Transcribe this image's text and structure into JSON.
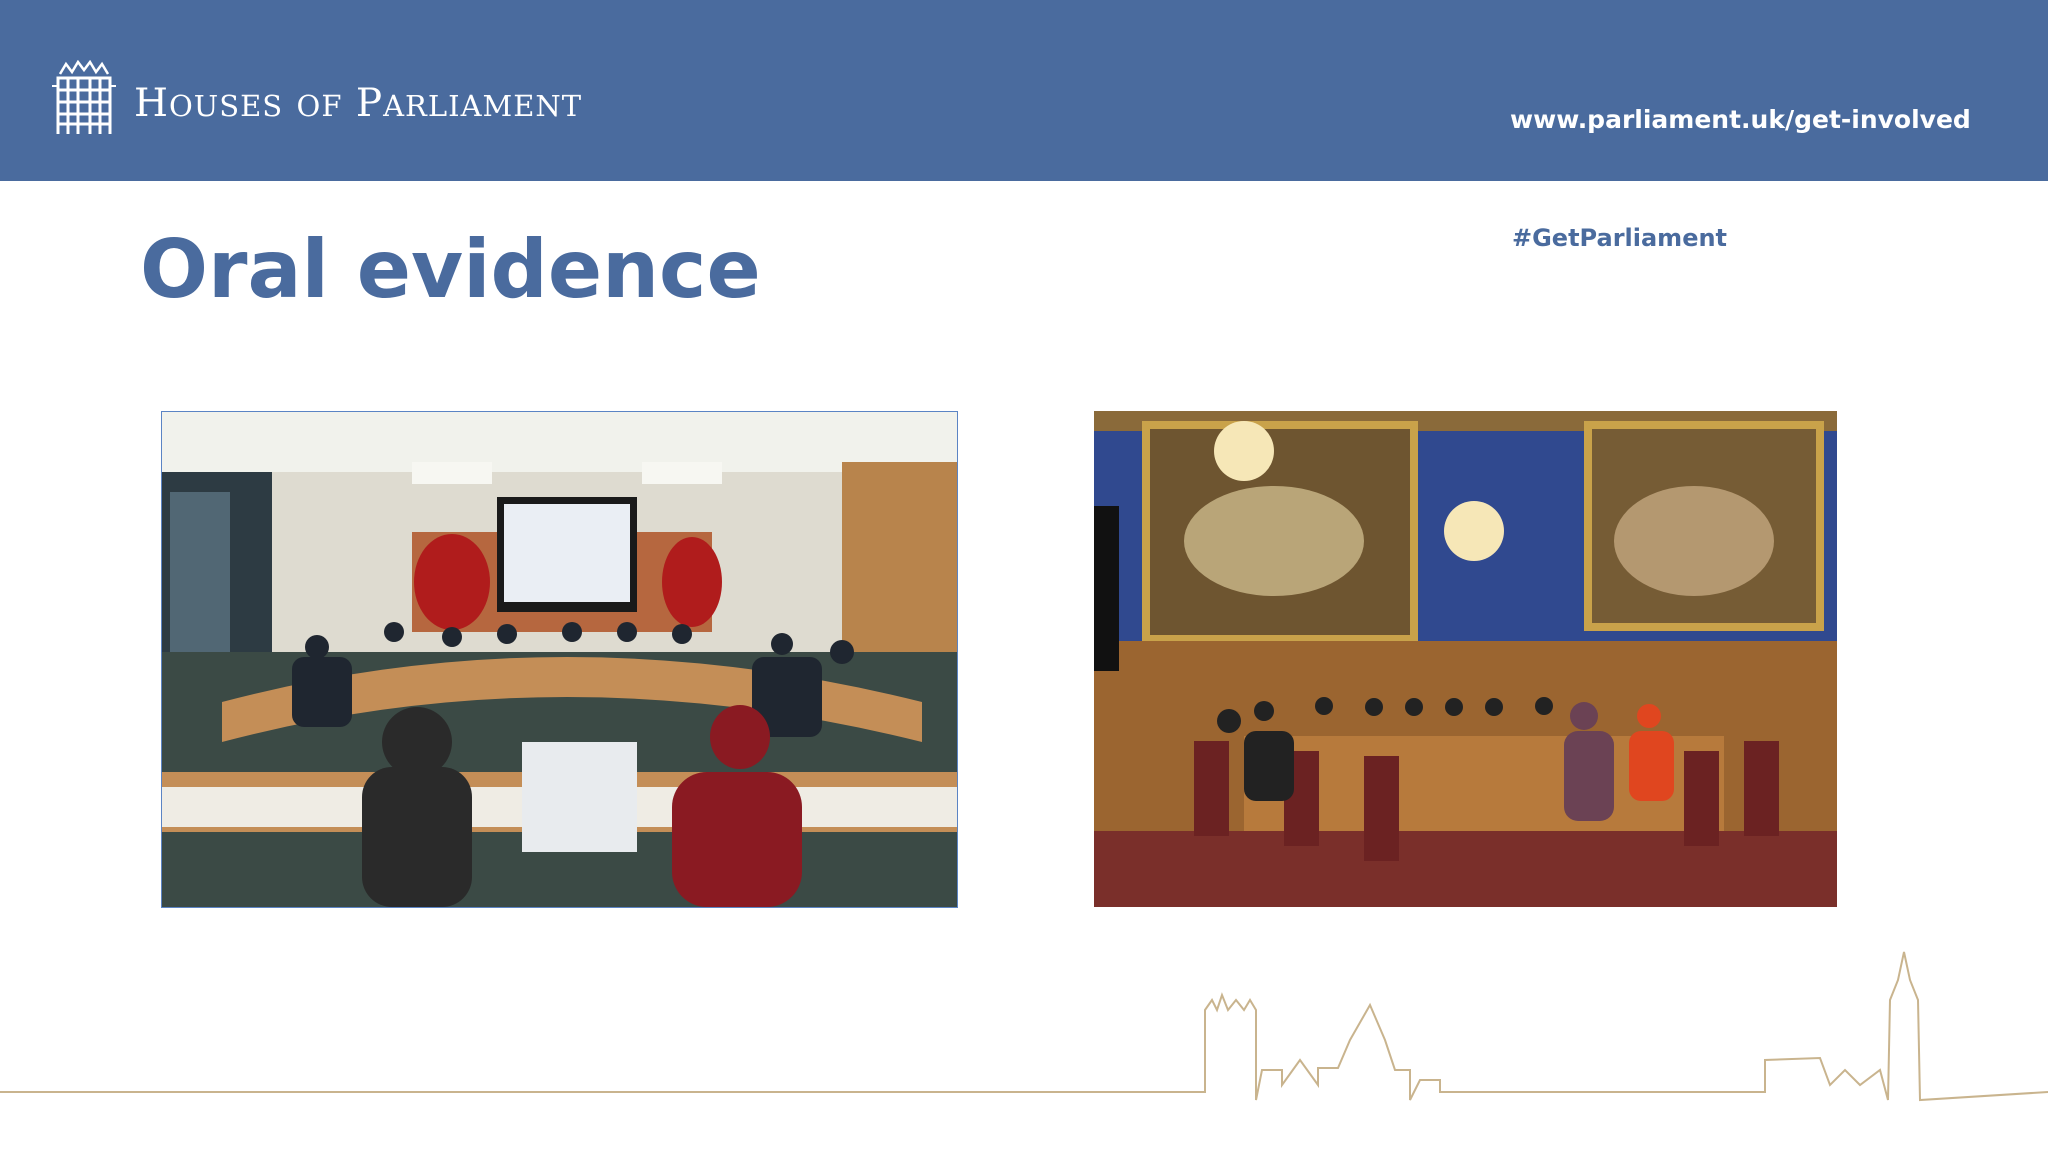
{
  "header": {
    "brand_initial_1": "H",
    "brand_rest_1": "OUSES",
    "brand_of": "OF",
    "brand_initial_2": "P",
    "brand_rest_2": "ARLIAMENT",
    "url": "www.parliament.uk/get-involved",
    "logo_icon": "portcullis-icon",
    "background_color": "#4a6b9e"
  },
  "slide": {
    "title": "Oral evidence",
    "hashtag": "#GetParliament",
    "title_color": "#4a6b9e"
  },
  "photos": [
    {
      "name": "committee-room-photo",
      "subject": "modern committee room hearing"
    },
    {
      "name": "historic-committee-room-photo",
      "subject": "ornate historic committee room hearing"
    }
  ],
  "footer": {
    "decoration": "westminster-skyline-outline",
    "line_color": "#c9b48e"
  }
}
